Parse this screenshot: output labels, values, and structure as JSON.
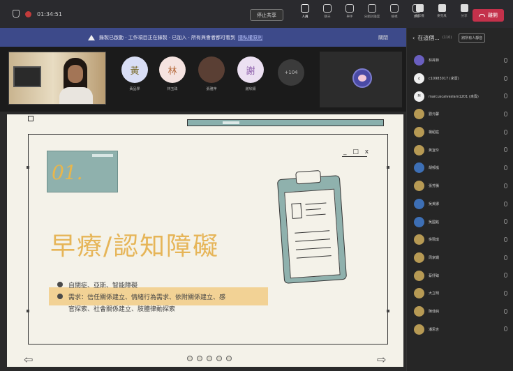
{
  "toolbar": {
    "timer": "01:34:51",
    "stop_share_label": "停止共享",
    "tools": [
      {
        "label": "人員",
        "icon": "people-icon",
        "active": true
      },
      {
        "label": "聊天",
        "icon": "chat-icon",
        "active": false
      },
      {
        "label": "舉手",
        "icon": "raise-hand-icon",
        "active": false
      },
      {
        "label": "分組討論室",
        "icon": "breakout-rooms-icon",
        "active": false
      },
      {
        "label": "檢視",
        "icon": "view-icon",
        "active": false
      },
      {
        "label": "更多",
        "icon": "more-icon",
        "active": false
      }
    ],
    "right_tools": [
      {
        "label": "攝影機",
        "icon": "camera-icon"
      },
      {
        "label": "麥克風",
        "icon": "mic-icon"
      },
      {
        "label": "分享",
        "icon": "share-icon"
      }
    ],
    "leave_label": "離開"
  },
  "banner": {
    "text": "錄製已啟動 · 工作項目正在錄製 · 已加入 · 所有與會者都可看到",
    "link": "隱私權原則",
    "dismiss": "關閉"
  },
  "participants_strip": [
    {
      "initial": "黃",
      "name": "黃品學",
      "color": "#d9def5",
      "fg": "#7a6b2a"
    },
    {
      "initial": "林",
      "name": "林玉珠",
      "color": "#f5e3e0",
      "fg": "#b6693a"
    },
    {
      "initial": "",
      "name": "張雅萍",
      "color": "#5a3f34",
      "fg": "#fff"
    },
    {
      "initial": "謝",
      "name": "謝欣穎",
      "color": "#ece0f2",
      "fg": "#8a5aa8"
    }
  ],
  "more_count": "+104",
  "slide": {
    "number": "01.",
    "title": "早療/認知障礙",
    "bullet1": "自閉症、亞斯、智能障礙",
    "bullet2a": "需求：信任關係建立、情緒行為需求、依附關係建立、感",
    "bullet2b": "官探索、社會關係建立、肢體律動探索",
    "window_controls": "_ □ x"
  },
  "panel": {
    "title": "在這個...",
    "count": "(110)",
    "mute_all": "將所有人靜音",
    "people": [
      {
        "initial": "",
        "name": "林昇鋒",
        "style": "photo"
      },
      {
        "initial": "¢",
        "name": "c10983017 (來賓)",
        "style": "white"
      },
      {
        "initial": "M",
        "name": "marcuscalveslam1201 (來賓)",
        "style": "white"
      },
      {
        "initial": "",
        "name": "劉元馨",
        "style": "gold"
      },
      {
        "initial": "",
        "name": "楊紹庭",
        "style": "gold"
      },
      {
        "initial": "",
        "name": "黃宜伶",
        "style": "gold"
      },
      {
        "initial": "",
        "name": "胡郁嵐",
        "style": "blue"
      },
      {
        "initial": "",
        "name": "張芳騰",
        "style": "gold"
      },
      {
        "initial": "",
        "name": "吳美娜",
        "style": "blue"
      },
      {
        "initial": "",
        "name": "吳國銘",
        "style": "blue"
      },
      {
        "initial": "",
        "name": "吳珮琪",
        "style": "gold"
      },
      {
        "initial": "",
        "name": "周家嫻",
        "style": "gold"
      },
      {
        "initial": "",
        "name": "蔡妤臻",
        "style": "gold"
      },
      {
        "initial": "",
        "name": "大立明",
        "style": "gold"
      },
      {
        "initial": "",
        "name": "陳佳純",
        "style": "gold"
      },
      {
        "initial": "",
        "name": "潘思含",
        "style": "gold"
      }
    ]
  }
}
